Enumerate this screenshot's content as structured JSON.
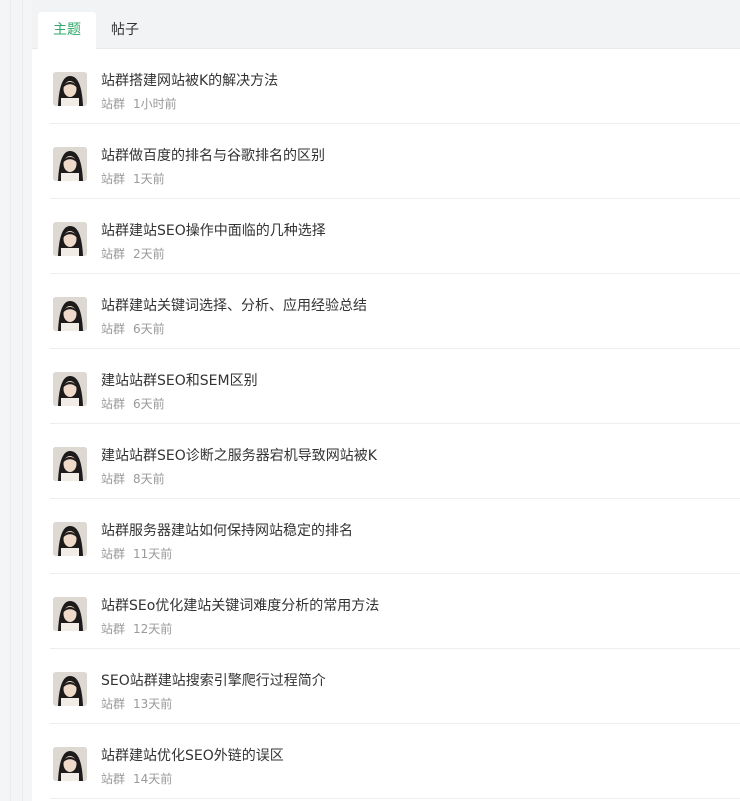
{
  "tabs": [
    {
      "label": "主题"
    },
    {
      "label": "帖子"
    }
  ],
  "topics": [
    {
      "title": "站群搭建网站被K的解决方法",
      "author": "站群",
      "time": "1小时前"
    },
    {
      "title": "站群做百度的排名与谷歌排名的区别",
      "author": "站群",
      "time": "1天前"
    },
    {
      "title": "站群建站SEO操作中面临的几种选择",
      "author": "站群",
      "time": "2天前"
    },
    {
      "title": "站群建站关键词选择、分析、应用经验总结",
      "author": "站群",
      "time": "6天前"
    },
    {
      "title": "建站站群SEO和SEM区别",
      "author": "站群",
      "time": "6天前"
    },
    {
      "title": "建站站群SEO诊断之服务器宕机导致网站被K",
      "author": "站群",
      "time": "8天前"
    },
    {
      "title": "站群服务器建站如何保持网站稳定的排名",
      "author": "站群",
      "time": "11天前"
    },
    {
      "title": "站群SEo优化建站关键词难度分析的常用方法",
      "author": "站群",
      "time": "12天前"
    },
    {
      "title": "SEO站群建站搜索引擎爬行过程简介",
      "author": "站群",
      "time": "13天前"
    },
    {
      "title": "站群建站优化SEO外链的误区",
      "author": "站群",
      "time": "14天前"
    }
  ]
}
